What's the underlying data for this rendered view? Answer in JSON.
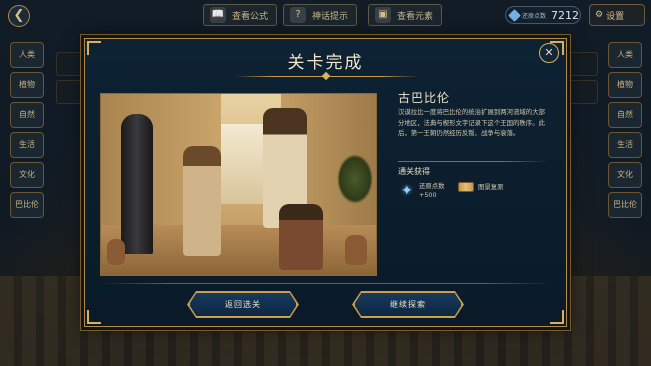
{
  "topbar": {
    "back_icon": "chevron-left-icon",
    "buttons": [
      {
        "label": "查看公式",
        "icon": "book-icon",
        "glyph": "📖"
      },
      {
        "label": "神话提示",
        "icon": "question-icon",
        "glyph": "?"
      },
      {
        "label": "查看元素",
        "icon": "box-icon",
        "glyph": "▣"
      }
    ],
    "points_label": "还原点数",
    "points_value": "7212",
    "settings_label": "设置",
    "settings_glyph": "⚙"
  },
  "left_rail": [
    "人类",
    "植物",
    "自然",
    "生活",
    "文化",
    "巴比伦"
  ],
  "right_rail": [
    "人类",
    "植物",
    "自然",
    "生活",
    "文化",
    "巴比伦"
  ],
  "dialog": {
    "title": "关卡完成",
    "close_glyph": "✕",
    "era_name": "古巴比伦",
    "description": "汉谟拉比一度将巴比伦的统治扩展到两河流域的大部分地区，法典与楔形文字记录下这个王国的秩序。此后，第一王朝仍然经历反叛、战争与衰落。",
    "rewards_title": "通关获得",
    "rewards": [
      {
        "label": "还原点数",
        "amount": "+500",
        "icon": "star-icon"
      },
      {
        "label": "图景复原",
        "icon": "scroll-icon"
      }
    ],
    "buttons": {
      "back": "返回选关",
      "continue": "继续探索"
    }
  },
  "colors": {
    "gold": "#d0a552",
    "panel": "#0d2233",
    "button": "#163a5e"
  }
}
